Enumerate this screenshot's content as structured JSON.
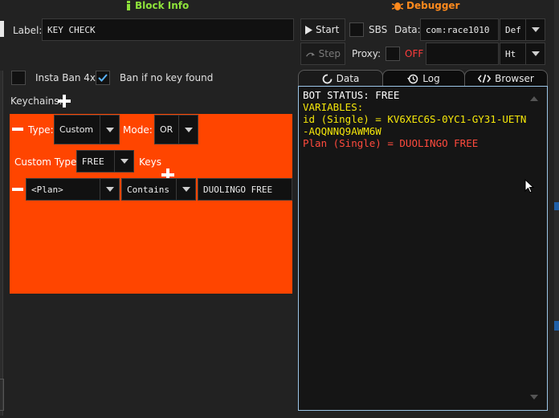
{
  "block_info": {
    "title": "Block Info"
  },
  "debugger": {
    "title": "Debugger"
  },
  "label": {
    "caption": "Label:",
    "value": "KEY CHECK"
  },
  "options": {
    "insta_ban": "Insta Ban 4xx",
    "insta_ban_checked": false,
    "ban_no_key": "Ban if no key found",
    "ban_no_key_checked": true
  },
  "keychains": {
    "caption": "Keychains:",
    "type_label": "Type:",
    "type_value": "Custom",
    "mode_label": "Mode:",
    "mode_value": "OR",
    "custom_type_label": "Custom Type:",
    "custom_type_value": "FREE",
    "keys_label": "Keys",
    "key_left": "<Plan>",
    "key_condition": "Contains",
    "key_right": "DUOLINGO FREE",
    "block_color": "#ff4500"
  },
  "toolbar": {
    "start": "Start",
    "step": "Step",
    "sbs": "SBS",
    "data_label": "Data:",
    "data_value": "com:race1010",
    "data_type": "Def",
    "proxy_label": "Proxy:",
    "proxy_state": "OFF",
    "proxy_type": "Ht"
  },
  "tabs": {
    "data": "Data",
    "log": "Log",
    "browser": "Browser"
  },
  "console": {
    "status": "BOT STATUS: FREE",
    "variables": "VARIABLES:",
    "id_line": "id (Single) = KV6XEC6S-0YC1-GY31-UETN-AQQNNQ9AWM6W",
    "plan_line": "Plan (Single) = DUOLINGO FREE",
    "colors": {
      "status": "#ffffff",
      "variables": "#f5e70a",
      "id": "#f5e70a",
      "plan": "#ff4a3d"
    }
  }
}
